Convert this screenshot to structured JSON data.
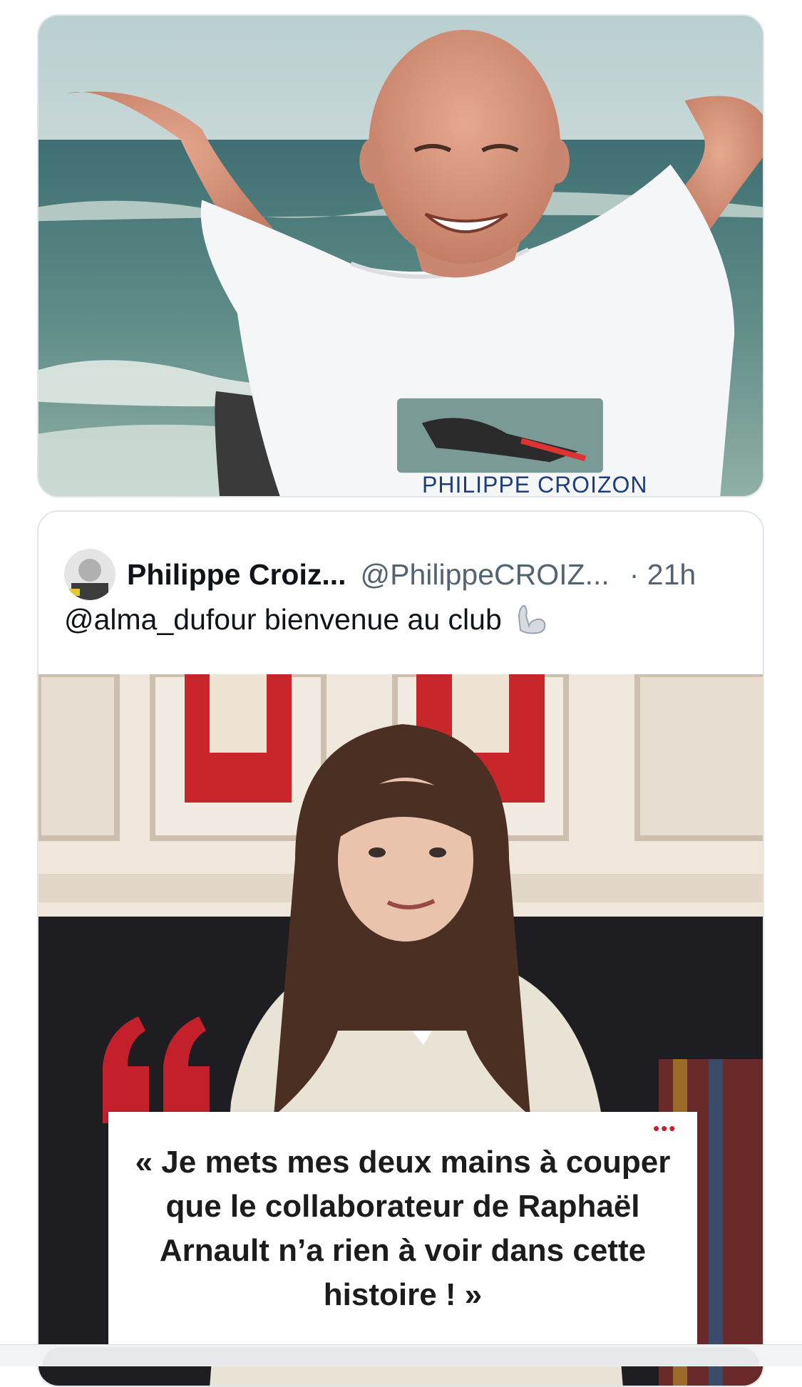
{
  "media_photo": {
    "shirt_caption": "PHILIPPE CROIZON"
  },
  "quoted_tweet": {
    "author_name": "Philippe Croiz...",
    "author_handle": "@PhilippeCROIZ...",
    "timestamp": "· 21h",
    "text": "@alma_dufour bienvenue au club",
    "emoji_icon": "flexed-biceps-icon",
    "image_quote": "« Je mets mes deux mains à couper que le collaborateur de Raphaël Arnault n’a rien à voir dans cette histoire ! »"
  },
  "colors": {
    "quote_red": "#c3202b",
    "text_primary": "#0f1419",
    "text_secondary": "#536471"
  }
}
